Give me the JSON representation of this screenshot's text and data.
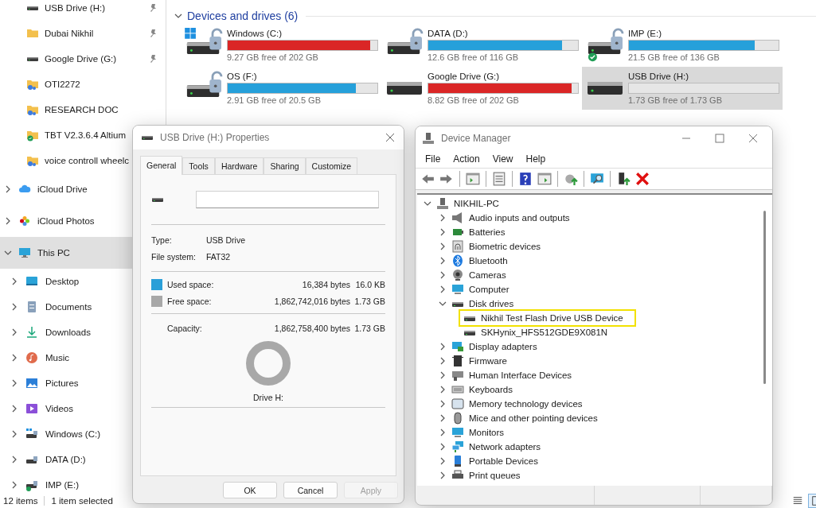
{
  "explorer": {
    "quick_access": [
      {
        "label": "USB Drive (H:)",
        "kind": "drive",
        "pinned": true
      },
      {
        "label": "Dubai Nikhil",
        "kind": "folder",
        "pinned": true
      },
      {
        "label": "Google Drive (G:)",
        "kind": "drive",
        "pinned": true
      },
      {
        "label": "OTI2272",
        "kind": "shared-folder",
        "pinned": false
      },
      {
        "label": "RESEARCH DOC",
        "kind": "shared-folder",
        "pinned": false
      },
      {
        "label": "TBT V2.3.6.4 Altium",
        "kind": "synced-folder",
        "pinned": false
      },
      {
        "label": "voice controll wheelc",
        "kind": "shared-folder",
        "pinned": false
      }
    ],
    "tree": [
      {
        "label": "iCloud Drive",
        "kind": "cloud",
        "expanded": false,
        "selected": false
      },
      {
        "label": "iCloud Photos",
        "kind": "photos",
        "expanded": false,
        "selected": false
      },
      {
        "label": "This PC",
        "kind": "pc",
        "expanded": true,
        "selected": true,
        "children": [
          {
            "label": "Desktop",
            "kind": "desktop",
            "expanded": false,
            "selected": false
          },
          {
            "label": "Documents",
            "kind": "documents",
            "expanded": false,
            "selected": false
          },
          {
            "label": "Downloads",
            "kind": "downloads",
            "expanded": false,
            "selected": false
          },
          {
            "label": "Music",
            "kind": "music",
            "expanded": false,
            "selected": false
          },
          {
            "label": "Pictures",
            "kind": "pictures",
            "expanded": false,
            "selected": false
          },
          {
            "label": "Videos",
            "kind": "videos",
            "expanded": false,
            "selected": false
          },
          {
            "label": "Windows (C:)",
            "kind": "system-drive",
            "expanded": false,
            "selected": false
          },
          {
            "label": "DATA (D:)",
            "kind": "locked-drive",
            "expanded": false,
            "selected": false
          },
          {
            "label": "IMP (E:)",
            "kind": "synced-drive",
            "expanded": false,
            "selected": false
          }
        ]
      }
    ],
    "section": {
      "title": "Devices and drives (6)",
      "expanded": true
    },
    "drives": [
      {
        "name": "Windows (C:)",
        "free": "9.27 GB free of 202 GB",
        "level": 0.954,
        "kind": "system",
        "locked": true,
        "selected": false
      },
      {
        "name": "DATA (D:)",
        "free": "12.6 GB free of 116 GB",
        "level": 0.891,
        "kind": "data",
        "locked": true,
        "selected": false
      },
      {
        "name": "IMP (E:)",
        "free": "21.5 GB free of 136 GB",
        "level": 0.842,
        "kind": "synced",
        "locked": true,
        "selected": false
      },
      {
        "name": "OS (F:)",
        "free": "2.91 GB free of 20.5 GB",
        "level": 0.858,
        "kind": "data",
        "locked": true,
        "selected": false
      },
      {
        "name": "Google Drive (G:)",
        "free": "8.82 GB free of 202 GB",
        "level": 0.956,
        "kind": "data",
        "locked": false,
        "selected": false
      },
      {
        "name": "USB Drive (H:)",
        "free": "1.73 GB free of 1.73 GB",
        "level": 0,
        "kind": "data",
        "locked": false,
        "selected": true
      }
    ],
    "status_bar": {
      "item_count": "12 items",
      "selection": "1 item selected"
    },
    "view_buttons": [
      {
        "kind": "details",
        "selected": false
      },
      {
        "kind": "tiles",
        "selected": true
      }
    ]
  },
  "properties": {
    "title": "USB Drive (H:) Properties",
    "tabs": [
      {
        "label": "General",
        "selected": true
      },
      {
        "label": "Tools",
        "selected": false
      },
      {
        "label": "Hardware",
        "selected": false
      },
      {
        "label": "Sharing",
        "selected": false
      },
      {
        "label": "Customize",
        "selected": false
      }
    ],
    "info": [
      {
        "label": "Type:",
        "value": "USB Drive"
      },
      {
        "label": "File system:",
        "value": "FAT32"
      }
    ],
    "space": [
      {
        "label": "Used space:",
        "bytes": "16,384 bytes",
        "size": "16.0 KB",
        "color": "#2a9fd8"
      },
      {
        "label": "Free space:",
        "bytes": "1,862,742,016 bytes",
        "size": "1.73 GB",
        "color": "#a8a8a8"
      }
    ],
    "capacity": {
      "label": "Capacity:",
      "bytes": "1,862,758,400 bytes",
      "size": "1.73 GB"
    },
    "drive_label": "Drive H:",
    "buttons": [
      {
        "label": "OK",
        "disabled": false
      },
      {
        "label": "Cancel",
        "disabled": false
      },
      {
        "label": "Apply",
        "disabled": true
      }
    ]
  },
  "device_manager": {
    "title": "Device Manager",
    "menu": [
      "File",
      "Action",
      "View",
      "Help"
    ],
    "toolbar": [
      {
        "kind": "back"
      },
      {
        "kind": "forward"
      },
      {
        "kind": "sep"
      },
      {
        "kind": "console-tree"
      },
      {
        "kind": "sep"
      },
      {
        "kind": "properties"
      },
      {
        "kind": "sep"
      },
      {
        "kind": "help"
      },
      {
        "kind": "action-pane"
      },
      {
        "kind": "sep"
      },
      {
        "kind": "update"
      },
      {
        "kind": "sep"
      },
      {
        "kind": "scan"
      },
      {
        "kind": "sep"
      },
      {
        "kind": "enable"
      },
      {
        "kind": "uninstall"
      }
    ],
    "tree": {
      "label": "NIKHIL-PC",
      "kind": "root",
      "expanded": true,
      "children": [
        {
          "label": "Audio inputs and outputs",
          "kind": "audio",
          "expanded": false
        },
        {
          "label": "Batteries",
          "kind": "battery",
          "expanded": false
        },
        {
          "label": "Biometric devices",
          "kind": "biometric",
          "expanded": false
        },
        {
          "label": "Bluetooth",
          "kind": "bluetooth",
          "expanded": false
        },
        {
          "label": "Cameras",
          "kind": "camera",
          "expanded": false
        },
        {
          "label": "Computer",
          "kind": "computer",
          "expanded": false
        },
        {
          "label": "Disk drives",
          "kind": "disk",
          "expanded": true,
          "children": [
            {
              "label": "Nikhil Test Flash Drive USB Device",
              "kind": "disk",
              "highlighted": true
            },
            {
              "label": "SKHynix_HFS512GDE9X081N",
              "kind": "disk",
              "highlighted": false
            }
          ]
        },
        {
          "label": "Display adapters",
          "kind": "display",
          "expanded": false
        },
        {
          "label": "Firmware",
          "kind": "firmware",
          "expanded": false
        },
        {
          "label": "Human Interface Devices",
          "kind": "hid",
          "expanded": false
        },
        {
          "label": "Keyboards",
          "kind": "keyboard",
          "expanded": false
        },
        {
          "label": "Memory technology devices",
          "kind": "memory",
          "expanded": false
        },
        {
          "label": "Mice and other pointing devices",
          "kind": "mouse",
          "expanded": false
        },
        {
          "label": "Monitors",
          "kind": "monitor",
          "expanded": false
        },
        {
          "label": "Network adapters",
          "kind": "network",
          "expanded": false
        },
        {
          "label": "Portable Devices",
          "kind": "portable",
          "expanded": false
        },
        {
          "label": "Print queues",
          "kind": "printer",
          "expanded": false
        }
      ]
    }
  }
}
